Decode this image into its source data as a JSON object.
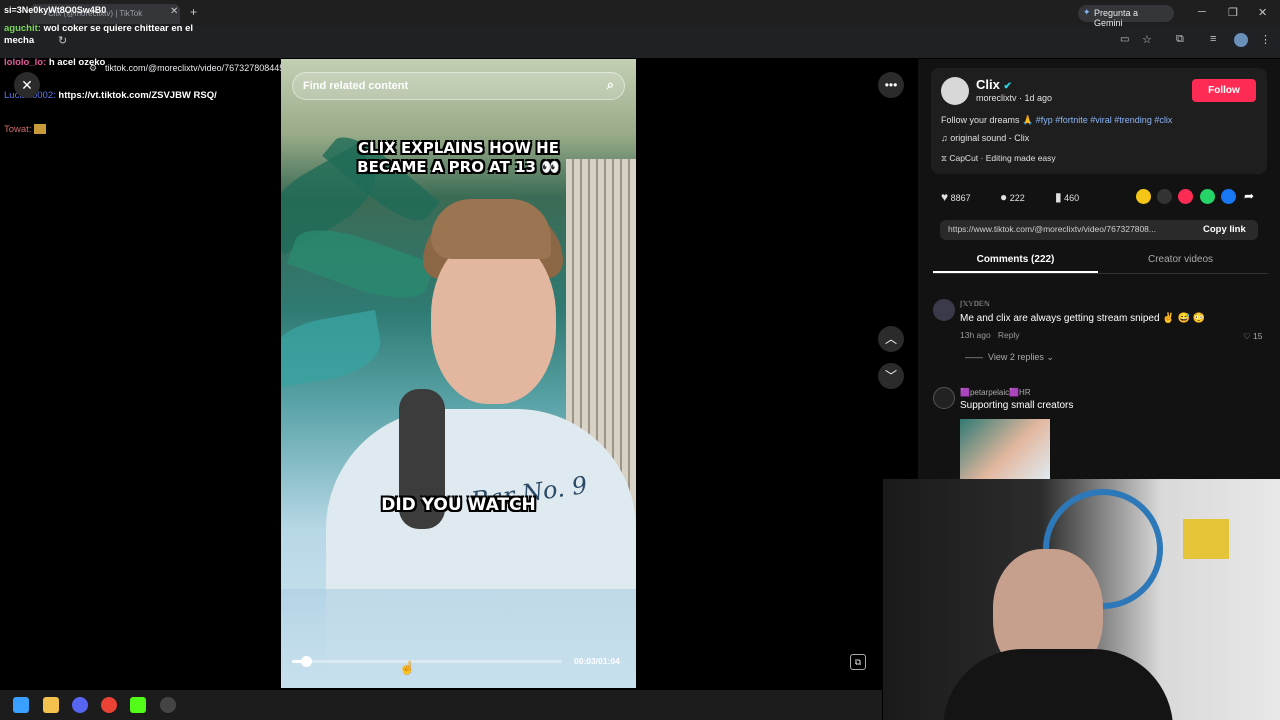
{
  "browser": {
    "tab_title": "Clix (@moreclixtv) | TikTok",
    "url": "tiktok.com/@moreclixtv/video/7673278084459662606",
    "gemini_label": "Pregunta a Gemini"
  },
  "chat": {
    "overlay_line": "si=3Ne0kyWt8O0Sw4B0",
    "messages": [
      {
        "user": "aguchit:",
        "text": "wol coker se quiere chittear en el mecha",
        "color": "#7ad35a"
      },
      {
        "user": "lololo_lo:",
        "text": "h acel ozeko",
        "color": "#e35a9d"
      },
      {
        "user": "Luciano002:",
        "text": "https://vt.tiktok.com/ZSVJBW RSQ/",
        "color": "#5d7cf2"
      },
      {
        "user": "Towat:",
        "text": "",
        "color": "#d06b6b"
      }
    ]
  },
  "video": {
    "search_placeholder": "Find related content",
    "caption_top": "CLIX EXPLAINS HOW HE BECAME A PRO AT 13 👀",
    "caption_mid": "DID YOU WATCH",
    "shirt_text": "Bar No. 9",
    "time": "00:03/01:04",
    "progress": 0.05
  },
  "author": {
    "name": "Clix",
    "handle": "moreclixtv",
    "age": "1d ago",
    "follow_label": "Follow",
    "description_prefix": "Follow your dreams 🙏",
    "hashtags": "#fyp #fortnite #viral #trending #clix",
    "sound": "original sound - Clix",
    "capcut": "CapCut · Editing made easy"
  },
  "stats": {
    "likes": "8867",
    "comments": "222",
    "saves": "460"
  },
  "link": {
    "url": "https://www.tiktok.com/@moreclixtv/video/767327808...",
    "copy_label": "Copy link"
  },
  "tabs": {
    "comments": "Comments (222)",
    "creator": "Creator videos"
  },
  "comments": [
    {
      "user": "𝕁𝕏𝕐𝔻𝔼ℕ",
      "text": "Me and clix are always getting stream sniped ✌️ 😅 😳",
      "age": "13h ago",
      "reply": "Reply",
      "likes": "15",
      "view_replies": "View 2 replies"
    },
    {
      "user": "🟪petarpelaic🟪HR",
      "text": "Supporting small creators"
    }
  ],
  "colors": {
    "accent": "#fe2c55",
    "link": "#8ab4f8",
    "verified": "#20d5ec"
  }
}
